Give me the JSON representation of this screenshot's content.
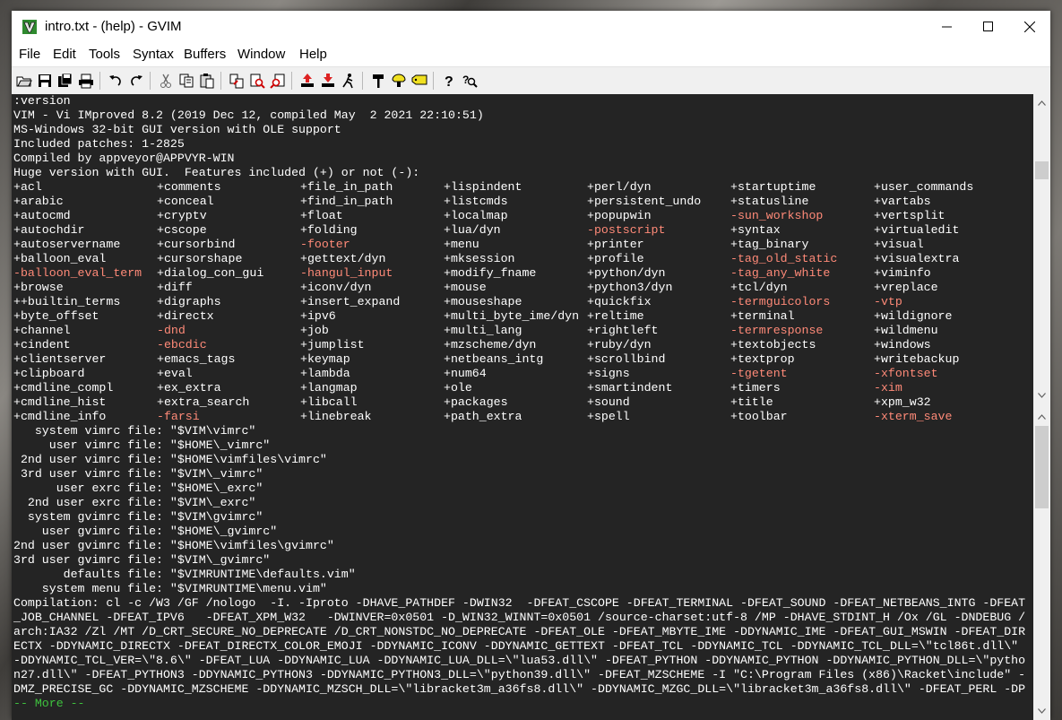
{
  "window": {
    "title": "intro.txt - (help) - GVIM"
  },
  "menu": [
    "File",
    "Edit",
    "Tools",
    "Syntax",
    "Buffers",
    "Window",
    "Help"
  ],
  "toolbar_icons": [
    "open-icon",
    "save-icon",
    "save-all-icon",
    "print-icon",
    "undo-icon",
    "redo-icon",
    "cut-icon",
    "copy-icon",
    "paste-icon",
    "replace-icon",
    "find-next-icon",
    "find-prev-icon",
    "load-session-icon",
    "save-session-icon",
    "run-script-icon",
    "make-icon",
    "shell-icon",
    "tags-icon",
    "help-icon",
    "find-help-icon"
  ],
  "header_lines": [
    ":version",
    "VIM - Vi IMproved 8.2 (2019 Dec 12, compiled May  2 2021 22:10:51)",
    "MS-Windows 32-bit GUI version with OLE support",
    "Included patches: 1-2825",
    "Compiled by appveyor@APPVYR-WIN",
    "Huge version with GUI.  Features included (+) or not (-):"
  ],
  "features": [
    [
      "+acl",
      "+comments",
      "+file_in_path",
      "+lispindent",
      "+perl/dyn",
      "+startuptime",
      "+user_commands"
    ],
    [
      "+arabic",
      "+conceal",
      "+find_in_path",
      "+listcmds",
      "+persistent_undo",
      "+statusline",
      "+vartabs"
    ],
    [
      "+autocmd",
      "+cryptv",
      "+float",
      "+localmap",
      "+popupwin",
      "-sun_workshop",
      "+vertsplit"
    ],
    [
      "+autochdir",
      "+cscope",
      "+folding",
      "+lua/dyn",
      "-postscript",
      "+syntax",
      "+virtualedit"
    ],
    [
      "+autoservername",
      "+cursorbind",
      "-footer",
      "+menu",
      "+printer",
      "+tag_binary",
      "+visual"
    ],
    [
      "+balloon_eval",
      "+cursorshape",
      "+gettext/dyn",
      "+mksession",
      "+profile",
      "-tag_old_static",
      "+visualextra"
    ],
    [
      "-balloon_eval_term",
      "+dialog_con_gui",
      "-hangul_input",
      "+modify_fname",
      "+python/dyn",
      "-tag_any_white",
      "+viminfo"
    ],
    [
      "+browse",
      "+diff",
      "+iconv/dyn",
      "+mouse",
      "+python3/dyn",
      "+tcl/dyn",
      "+vreplace"
    ],
    [
      "++builtin_terms",
      "+digraphs",
      "+insert_expand",
      "+mouseshape",
      "+quickfix",
      "-termguicolors",
      "-vtp"
    ],
    [
      "+byte_offset",
      "+directx",
      "+ipv6",
      "+multi_byte_ime/dyn",
      "+reltime",
      "+terminal",
      "+wildignore"
    ],
    [
      "+channel",
      "-dnd",
      "+job",
      "+multi_lang",
      "+rightleft",
      "-termresponse",
      "+wildmenu"
    ],
    [
      "+cindent",
      "-ebcdic",
      "+jumplist",
      "+mzscheme/dyn",
      "+ruby/dyn",
      "+textobjects",
      "+windows"
    ],
    [
      "+clientserver",
      "+emacs_tags",
      "+keymap",
      "+netbeans_intg",
      "+scrollbind",
      "+textprop",
      "+writebackup"
    ],
    [
      "+clipboard",
      "+eval",
      "+lambda",
      "+num64",
      "+signs",
      "-tgetent",
      "-xfontset"
    ],
    [
      "+cmdline_compl",
      "+ex_extra",
      "+langmap",
      "+ole",
      "+smartindent",
      "+timers",
      "-xim"
    ],
    [
      "+cmdline_hist",
      "+extra_search",
      "+libcall",
      "+packages",
      "+sound",
      "+title",
      "+xpm_w32"
    ],
    [
      "+cmdline_info",
      "-farsi",
      "+linebreak",
      "+path_extra",
      "+spell",
      "+toolbar",
      "-xterm_save"
    ]
  ],
  "vimrc_lines": [
    "   system vimrc file: \"$VIM\\vimrc\"",
    "     user vimrc file: \"$HOME\\_vimrc\"",
    " 2nd user vimrc file: \"$HOME\\vimfiles\\vimrc\"",
    " 3rd user vimrc file: \"$VIM\\_vimrc\"",
    "      user exrc file: \"$HOME\\_exrc\"",
    "  2nd user exrc file: \"$VIM\\_exrc\"",
    "  system gvimrc file: \"$VIM\\gvimrc\"",
    "    user gvimrc file: \"$HOME\\_gvimrc\"",
    "2nd user gvimrc file: \"$HOME\\vimfiles\\gvimrc\"",
    "3rd user gvimrc file: \"$VIM\\_gvimrc\"",
    "       defaults file: \"$VIMRUNTIME\\defaults.vim\"",
    "    system menu file: \"$VIMRUNTIME\\menu.vim\""
  ],
  "compilation_lines": [
    "Compilation: cl -c /W3 /GF /nologo  -I. -Iproto -DHAVE_PATHDEF -DWIN32  -DFEAT_CSCOPE -DFEAT_TERMINAL -DFEAT_SOUND -DFEAT_NETBEANS_INTG -DFEAT",
    "_JOB_CHANNEL -DFEAT_IPV6   -DFEAT_XPM_W32   -DWINVER=0x0501 -D_WIN32_WINNT=0x0501 /source-charset:utf-8 /MP -DHAVE_STDINT_H /Ox /GL -DNDEBUG /",
    "arch:IA32 /Zl /MT /D_CRT_SECURE_NO_DEPRECATE /D_CRT_NONSTDC_NO_DEPRECATE -DFEAT_OLE -DFEAT_MBYTE_IME -DDYNAMIC_IME -DFEAT_GUI_MSWIN -DFEAT_DIR",
    "ECTX -DDYNAMIC_DIRECTX -DFEAT_DIRECTX_COLOR_EMOJI -DDYNAMIC_ICONV -DDYNAMIC_GETTEXT -DFEAT_TCL -DDYNAMIC_TCL -DDYNAMIC_TCL_DLL=\\\"tcl86t.dll\\\"",
    "-DDYNAMIC_TCL_VER=\\\"8.6\\\" -DFEAT_LUA -DDYNAMIC_LUA -DDYNAMIC_LUA_DLL=\\\"lua53.dll\\\" -DFEAT_PYTHON -DDYNAMIC_PYTHON -DDYNAMIC_PYTHON_DLL=\\\"pytho",
    "n27.dll\\\" -DFEAT_PYTHON3 -DDYNAMIC_PYTHON3 -DDYNAMIC_PYTHON3_DLL=\\\"python39.dll\\\" -DFEAT_MZSCHEME -I \"C:\\Program Files (x86)\\Racket\\include\" -",
    "DMZ_PRECISE_GC -DDYNAMIC_MZSCHEME -DDYNAMIC_MZSCH_DLL=\\\"libracket3m_a36fs8.dll\\\" -DDYNAMIC_MZGC_DLL=\\\"libracket3m_a36fs8.dll\\\" -DFEAT_PERL -DP"
  ],
  "more_prompt": "-- More --",
  "colors": {
    "editor_bg": "#242424",
    "text": "#ffffff",
    "excluded_feature": "#ff8a78",
    "more_prompt": "#3ec23e"
  }
}
